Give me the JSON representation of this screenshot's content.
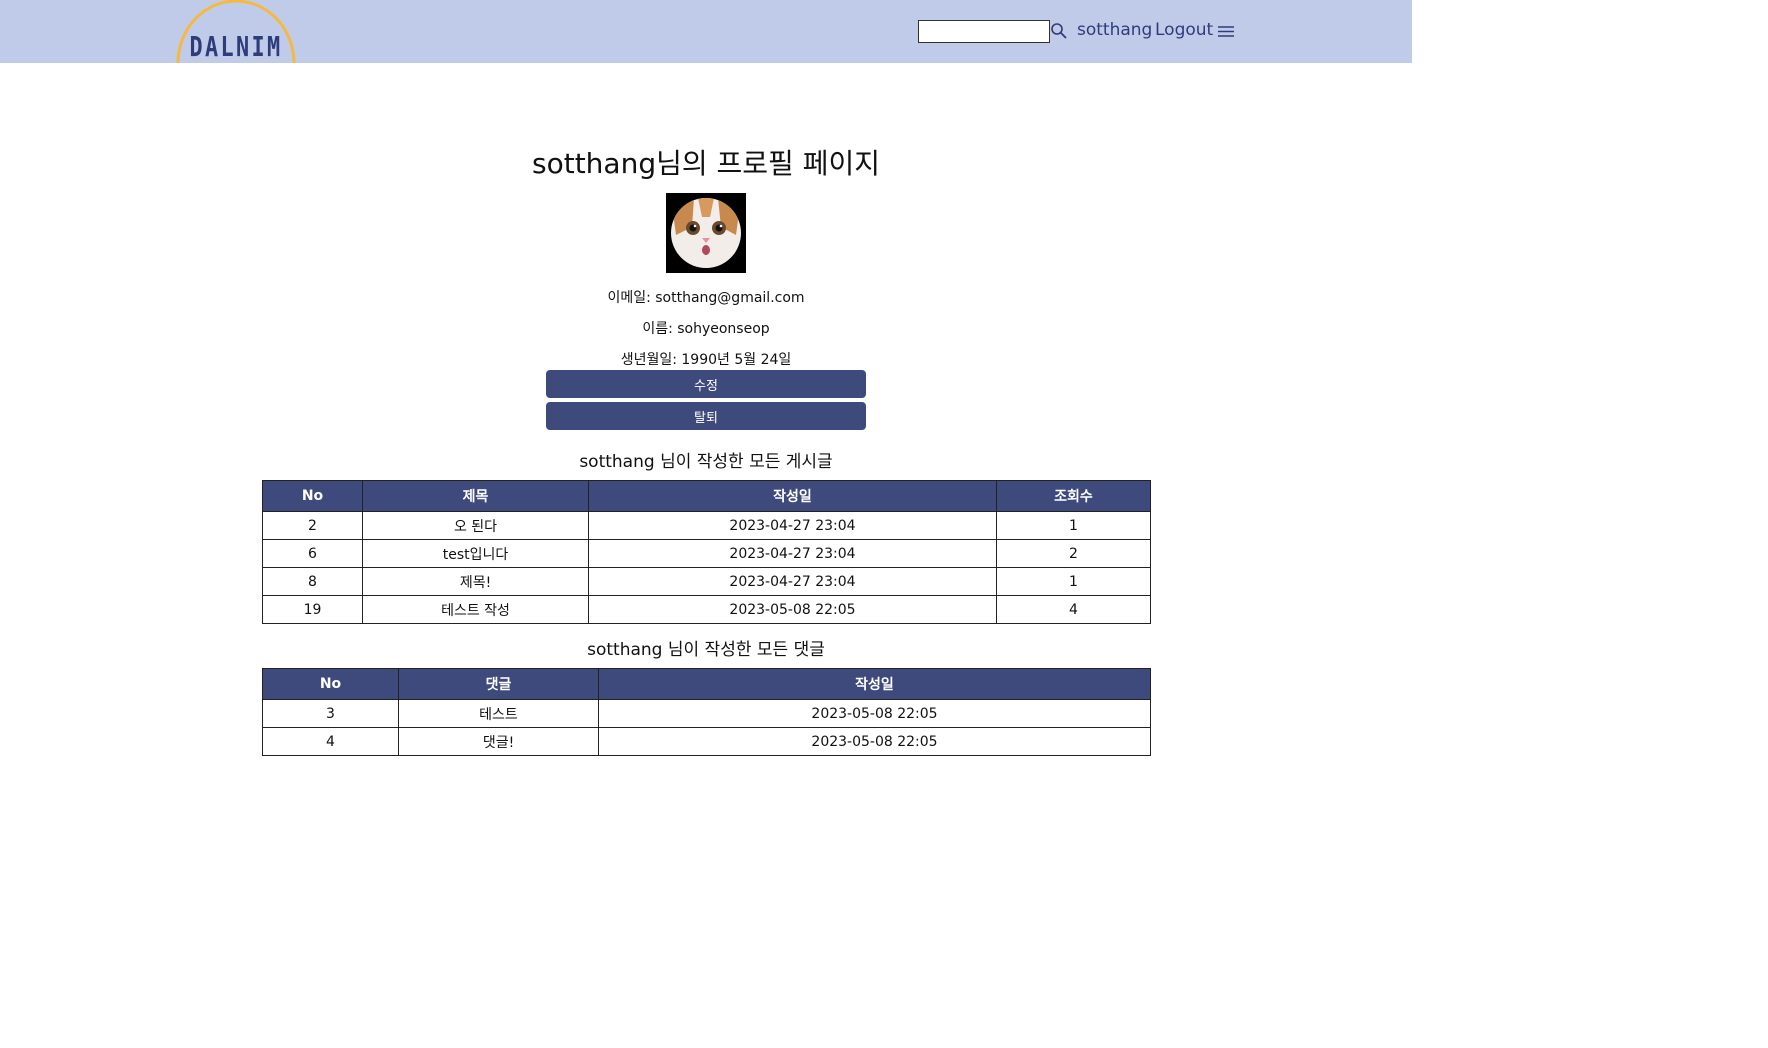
{
  "header": {
    "logo_text": "DALNIM",
    "search_placeholder": "",
    "username": "sotthang",
    "logout_label": "Logout",
    "colors": {
      "bar": "#c0cbea",
      "logo_arc": "#f5b942",
      "logo_text": "#2f3c7a"
    }
  },
  "profile": {
    "title": "sotthang님의 프로필 페이지",
    "email_line": "이메일: sotthang@gmail.com",
    "name_line": "이름: sohyeonseop",
    "birth_line": "생년월일: 1990년 5월 24일",
    "edit_label": "수정",
    "withdraw_label": "탈퇴"
  },
  "posts": {
    "title": "sotthang 님이 작성한 모든 게시글",
    "headers": [
      "No",
      "제목",
      "작성일",
      "조회수"
    ],
    "rows": [
      [
        "2",
        "오 된다",
        "2023-04-27 23:04",
        "1"
      ],
      [
        "6",
        "test입니다",
        "2023-04-27 23:04",
        "2"
      ],
      [
        "8",
        "제목!",
        "2023-04-27 23:04",
        "1"
      ],
      [
        "19",
        "테스트 작성",
        "2023-05-08 22:05",
        "4"
      ]
    ]
  },
  "comments": {
    "title": "sotthang 님이 작성한 모든 댓글",
    "headers": [
      "No",
      "댓글",
      "작성일"
    ],
    "rows": [
      [
        "3",
        "테스트",
        "2023-05-08 22:05"
      ],
      [
        "4",
        "댓글!",
        "2023-05-08 22:05"
      ]
    ]
  },
  "accent_color": "#3e4a7c"
}
